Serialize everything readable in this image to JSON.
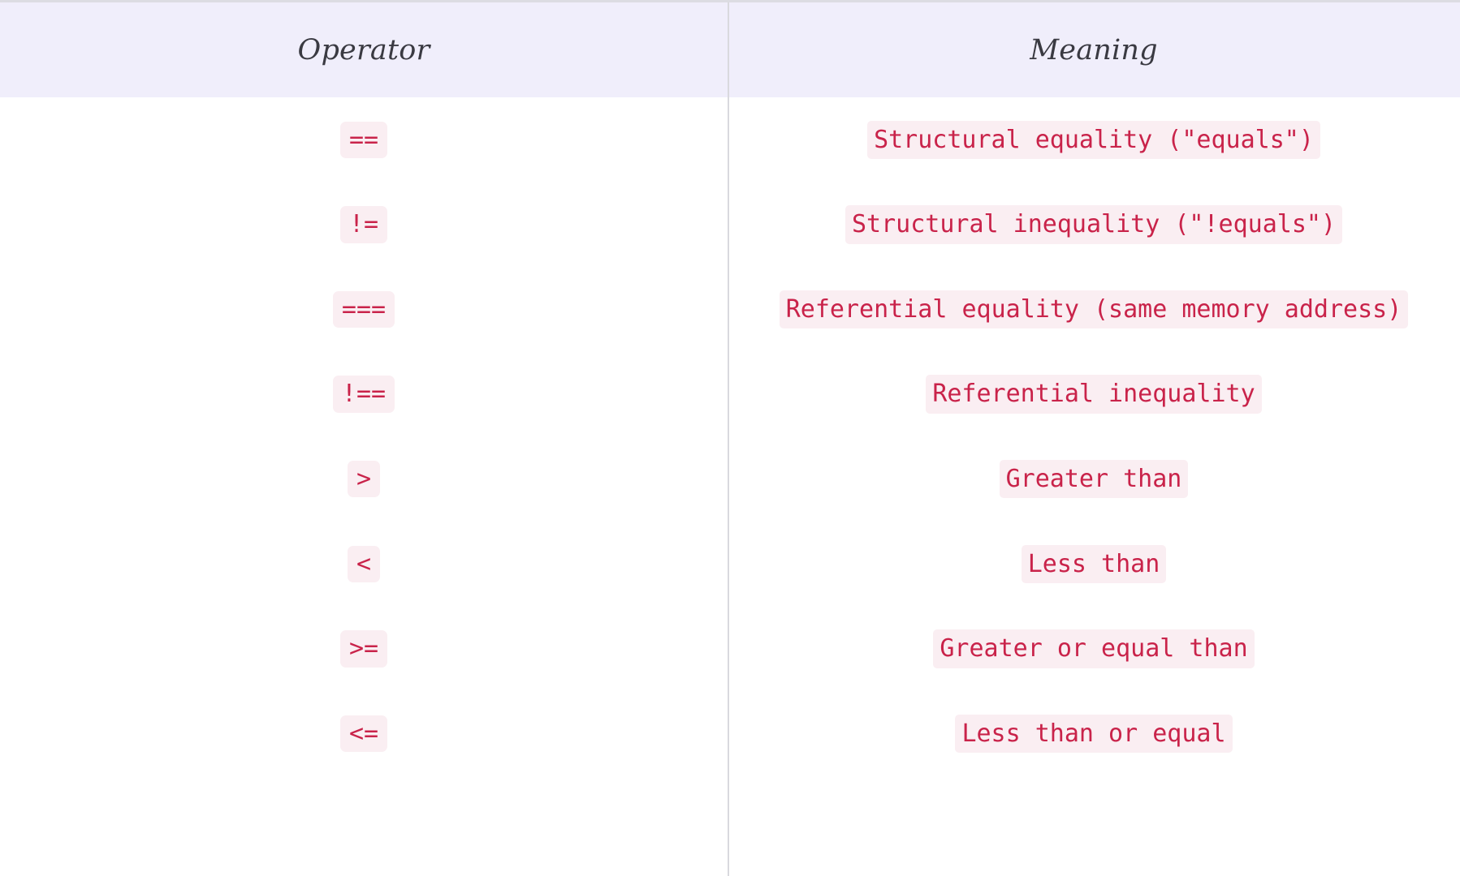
{
  "table": {
    "columns": [
      {
        "key": "operator",
        "label": "Operator"
      },
      {
        "key": "meaning",
        "label": "Meaning"
      }
    ],
    "rows": [
      {
        "operator": "==",
        "meaning": "Structural equality (\"equals\")"
      },
      {
        "operator": "!=",
        "meaning": "Structural inequality (\"!equals\")"
      },
      {
        "operator": "===",
        "meaning": "Referential equality (same memory address)"
      },
      {
        "operator": "!==",
        "meaning": "Referential inequality"
      },
      {
        "operator": ">",
        "meaning": "Greater than"
      },
      {
        "operator": "<",
        "meaning": "Less than"
      },
      {
        "operator": ">=",
        "meaning": "Greater or equal than"
      },
      {
        "operator": "<=",
        "meaning": "Less than or equal"
      }
    ]
  },
  "colors": {
    "header_background": "#f0eefb",
    "header_text": "#3a3a42",
    "code_text": "#c9234a",
    "code_background": "#faeef2",
    "divider": "#d9d9de",
    "page_background": "#ffffff",
    "top_border": "#dcdce2"
  }
}
